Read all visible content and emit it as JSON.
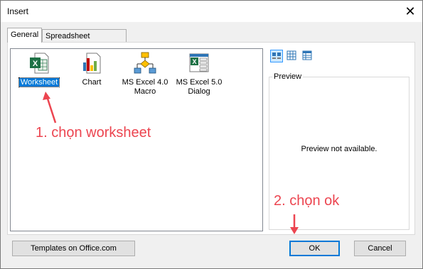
{
  "dialog": {
    "title": "Insert"
  },
  "tabs": [
    {
      "label": "General"
    },
    {
      "label": "Spreadsheet Solutions"
    }
  ],
  "items": [
    {
      "label": "Worksheet",
      "icon": "worksheet-icon",
      "selected": true
    },
    {
      "label": "Chart",
      "icon": "chart-icon"
    },
    {
      "label": "MS Excel 4.0 Macro",
      "icon": "macro-icon"
    },
    {
      "label": "MS Excel 5.0 Dialog",
      "icon": "dialog-icon"
    }
  ],
  "view_buttons": [
    "large-icons-view-icon",
    "list-view-icon",
    "details-view-icon"
  ],
  "preview": {
    "title": "Preview",
    "message": "Preview not available."
  },
  "buttons": {
    "templates": "Templates on Office.com",
    "ok": "OK",
    "cancel": "Cancel"
  },
  "annotations": {
    "step1": "1. chọn worksheet",
    "step2": "2. chọn ok"
  },
  "colors": {
    "accent": "#0078d7",
    "annotation": "#ec4550",
    "excel_green": "#1e7145"
  }
}
